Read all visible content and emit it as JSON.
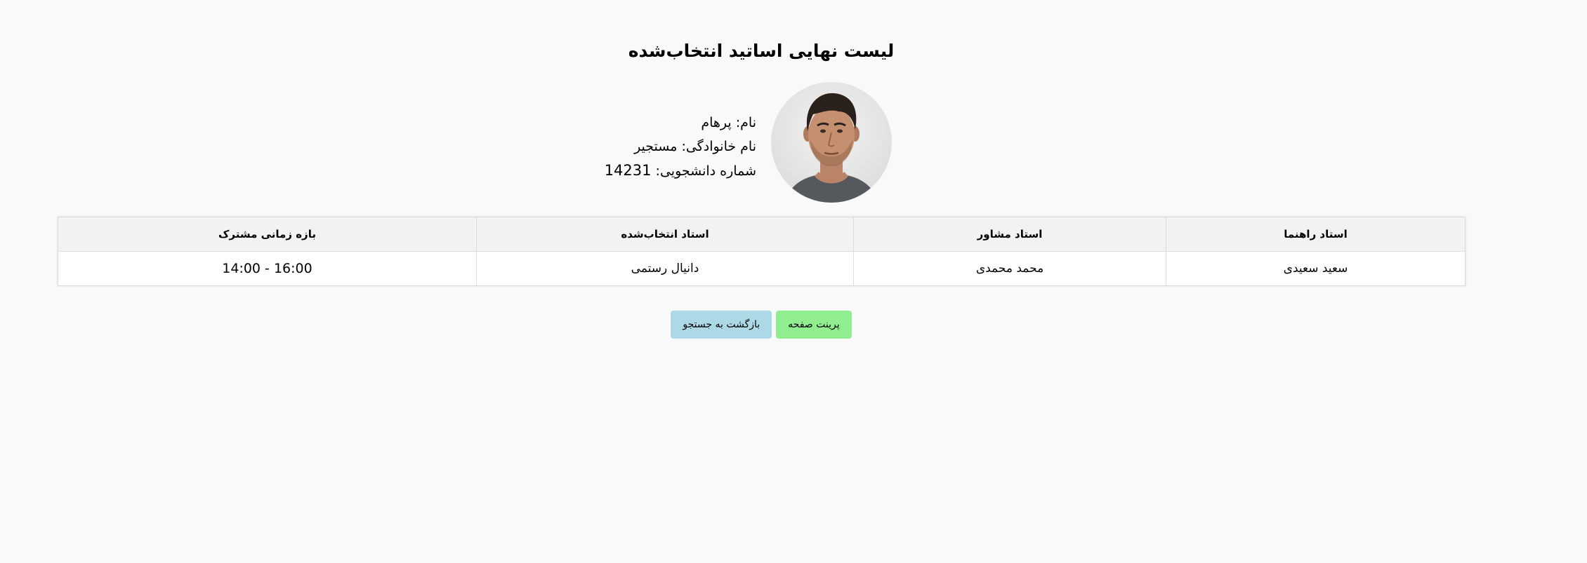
{
  "page": {
    "title": "لیست نهایی اساتید انتخاب‌شده"
  },
  "student": {
    "first_name_line": "نام: پرهام",
    "last_name_line": "نام خانوادگی: مستجیر",
    "student_id_label": "شماره دانشجویی: ",
    "student_id_value": "14231"
  },
  "table": {
    "headers": [
      "استاد راهنما",
      "استاد مشاور",
      "استاد انتخاب‌شده",
      "بازه زمانی مشترک"
    ],
    "rows": [
      [
        "سعید سعیدی",
        "محمد محمدی",
        "دانیال رستمی",
        "14:00 - 16:00"
      ]
    ]
  },
  "actions": {
    "print_label": "پرینت صفحه",
    "back_label": "بازگشت به جستجو"
  },
  "colors": {
    "print_button": "#90ee90",
    "back_button": "#add8e6",
    "background": "#f9f9f9"
  }
}
